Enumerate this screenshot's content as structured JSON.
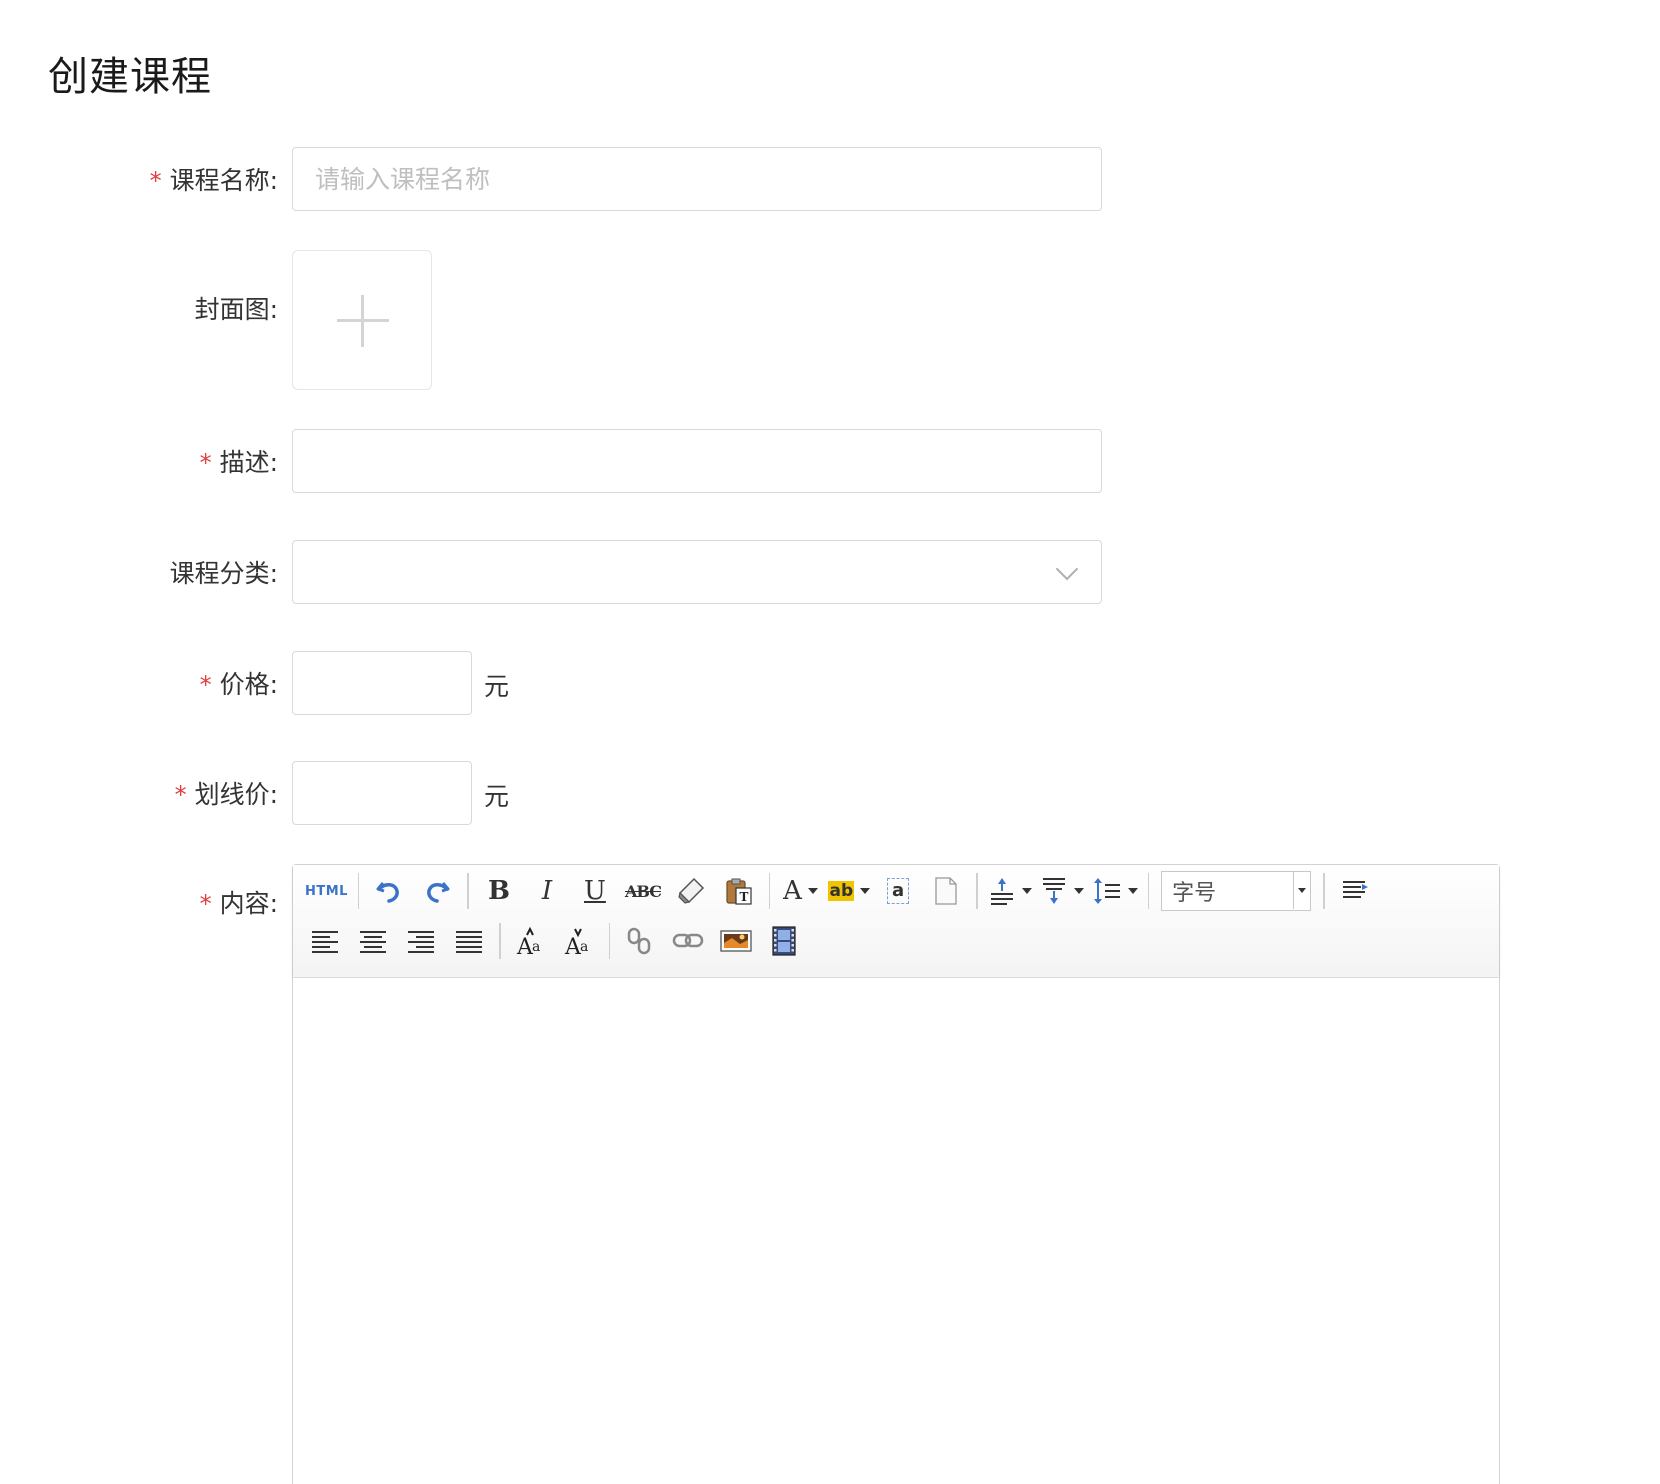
{
  "page": {
    "title": "创建课程"
  },
  "form": {
    "course_name": {
      "label": "课程名称:",
      "required": true,
      "placeholder": "请输入课程名称",
      "value": ""
    },
    "cover": {
      "label": "封面图:",
      "required": false
    },
    "description": {
      "label": "描述:",
      "required": true,
      "value": ""
    },
    "category": {
      "label": "课程分类:",
      "required": false,
      "value": ""
    },
    "price": {
      "label": "价格:",
      "required": true,
      "value": "",
      "unit": "元"
    },
    "strike_price": {
      "label": "划线价:",
      "required": true,
      "value": "",
      "unit": "元"
    },
    "content": {
      "label": "内容:",
      "required": true
    }
  },
  "required_mark": "*",
  "editor": {
    "toolbar_row1": [
      "html-source",
      "undo",
      "redo",
      "bold",
      "italic",
      "underline",
      "strikethrough",
      "eraser",
      "paste-text",
      "font-color",
      "highlight-color",
      "formatting-a",
      "blank-page",
      "paragraph-spacing-top",
      "paragraph-spacing-bottom",
      "line-height",
      "font-size",
      "format-paragraph"
    ],
    "toolbar_row2": [
      "align-left",
      "align-center",
      "align-right",
      "align-justify",
      "superscript",
      "subscript",
      "unlink",
      "link",
      "image",
      "video"
    ],
    "html_label": "HTML",
    "bold_label": "B",
    "italic_label": "I",
    "underline_label": "U",
    "strike_label": "ABC",
    "font_color_label": "A",
    "highlight_label": "ab",
    "formatting_label": "a",
    "font_size_placeholder": "字号"
  },
  "colors": {
    "required": "#e33d3d",
    "border": "#d9d9d9",
    "placeholder": "#bfbfbf",
    "toolbar_blue": "#3b73c8"
  }
}
